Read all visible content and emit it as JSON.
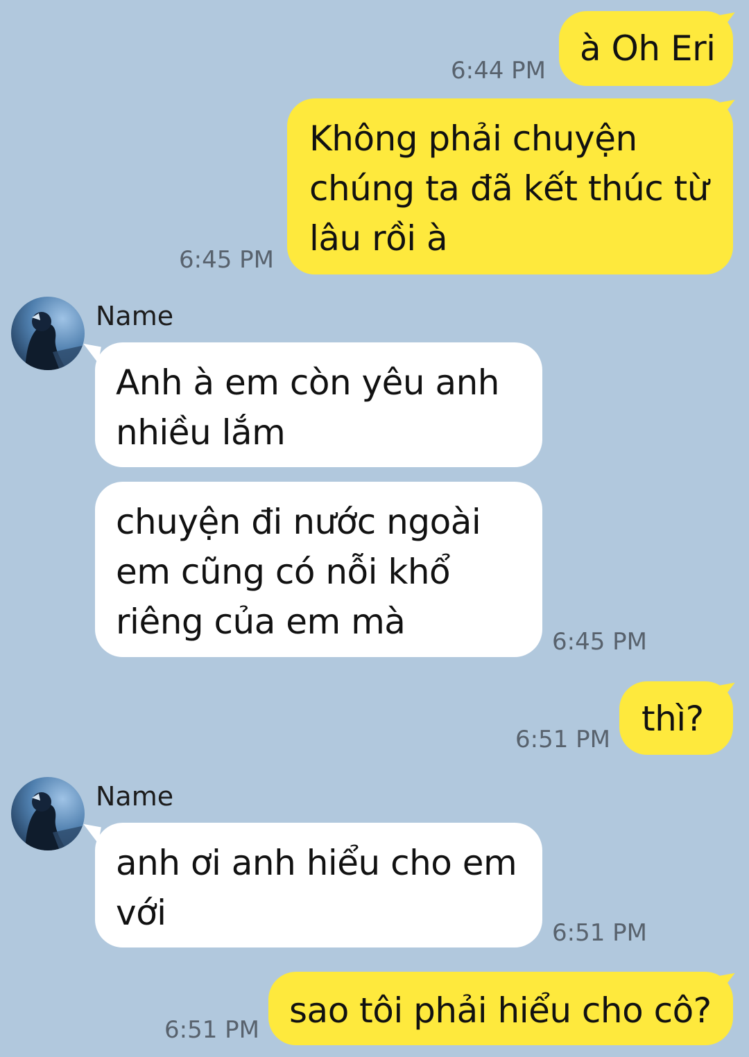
{
  "colors": {
    "background": "#b1c8dd",
    "sent_bubble": "#fee93d",
    "received_bubble": "#ffffff",
    "timestamp_text": "#58626d"
  },
  "messages": [
    {
      "type": "sent",
      "text": "à Oh Eri",
      "time": "6:44 PM"
    },
    {
      "type": "sent",
      "text": "Không phải chuyện\nchúng ta đã kết thúc từ\nlâu rồi à",
      "time": "6:45 PM"
    },
    {
      "type": "received",
      "sender": "Name",
      "avatar": "profile-photo",
      "text": "Anh à em còn yêu anh\nnhiều lắm",
      "time": ""
    },
    {
      "type": "received",
      "text": "chuyện đi nước ngoài\nem cũng có nỗi khổ\nriêng của em mà",
      "time": "6:45 PM"
    },
    {
      "type": "sent",
      "text": "thì?",
      "time": "6:51 PM"
    },
    {
      "type": "received",
      "sender": "Name",
      "avatar": "profile-photo",
      "text": "anh ơi anh hiểu cho em\nvới",
      "time": "6:51 PM"
    },
    {
      "type": "sent",
      "text": "sao tôi phải hiểu cho cô?",
      "time": "6:51 PM"
    }
  ]
}
